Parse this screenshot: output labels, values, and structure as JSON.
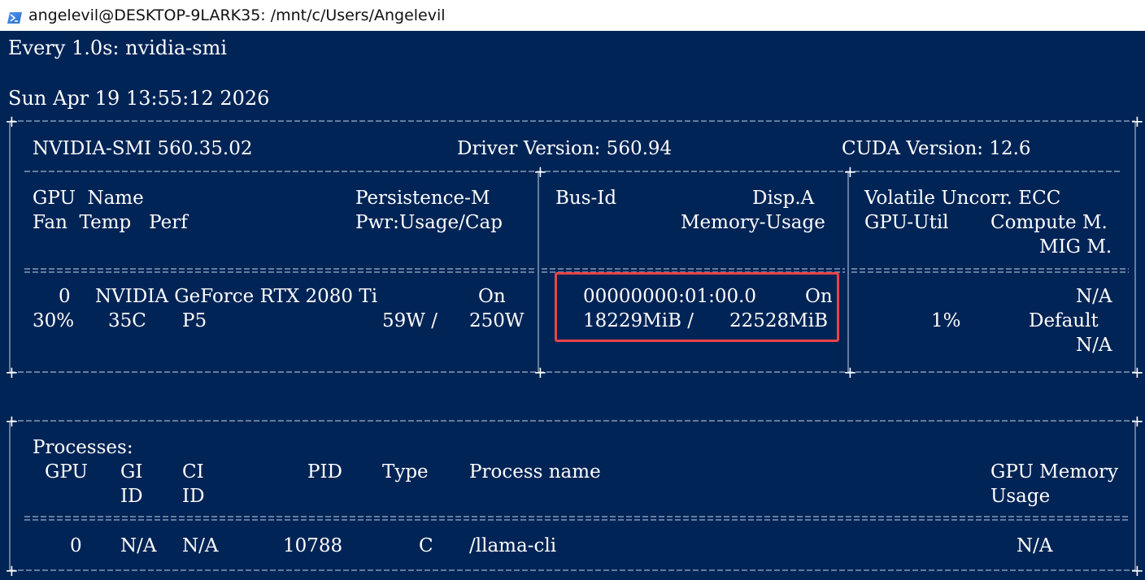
{
  "window": {
    "title": "angelevil@DESKTOP-9LARK35: /mnt/c/Users/Angelevil",
    "icon": "powershell-icon"
  },
  "terminal": {
    "watch_header": "Every 1.0s: nvidia-smi",
    "timestamp": "Sun Apr 19 13:55:12 2026",
    "header": {
      "smi_version": "NVIDIA-SMI 560.35.02",
      "driver_version": "Driver Version: 560.94",
      "cuda_version": "CUDA Version: 12.6"
    },
    "gpu_columns": {
      "c1_line1": "GPU  Name",
      "c1_line2": "Fan  Temp   Perf",
      "c1r_line1": "Persistence-M",
      "c1r_line2": "Pwr:Usage/Cap",
      "c2_line1_left": "Bus-Id",
      "c2_line1_right": "Disp.A",
      "c2_line2": "Memory-Usage",
      "c3_line1": "Volatile Uncorr. ECC",
      "c3_line2_left": "GPU-Util",
      "c3_line2_right": "Compute M.",
      "c3_line3": "MIG M."
    },
    "gpu": {
      "index": "0",
      "name": "NVIDIA GeForce RTX 2080 Ti",
      "persistence": "On",
      "fan": "30%",
      "temp": "35C",
      "perf": "P5",
      "power_usage": "59W /",
      "power_cap": "250W",
      "bus_id": "00000000:01:00.0",
      "disp_a": "On",
      "memory_used": "18229MiB /",
      "memory_total": "22528MiB",
      "volatile_ecc": "N/A",
      "gpu_util": "1%",
      "compute_mode": "Default",
      "mig_mode": "N/A"
    },
    "processes": {
      "title": "Processes:",
      "col_gpu": "GPU",
      "col_gi": "GI",
      "col_gi_2": "ID",
      "col_ci": "CI",
      "col_ci_2": "ID",
      "col_pid": "PID",
      "col_type": "Type",
      "col_name": "Process name",
      "col_mem": "GPU Memory",
      "col_mem_2": "Usage",
      "rows": [
        {
          "gpu": "0",
          "gi": "N/A",
          "ci": "N/A",
          "pid": "10788",
          "type": "C",
          "name": "/llama-cli",
          "mem": "N/A"
        }
      ]
    }
  },
  "colors": {
    "terminal_bg": "#012456",
    "text": "#ffffff",
    "highlight": "#e9444a"
  }
}
